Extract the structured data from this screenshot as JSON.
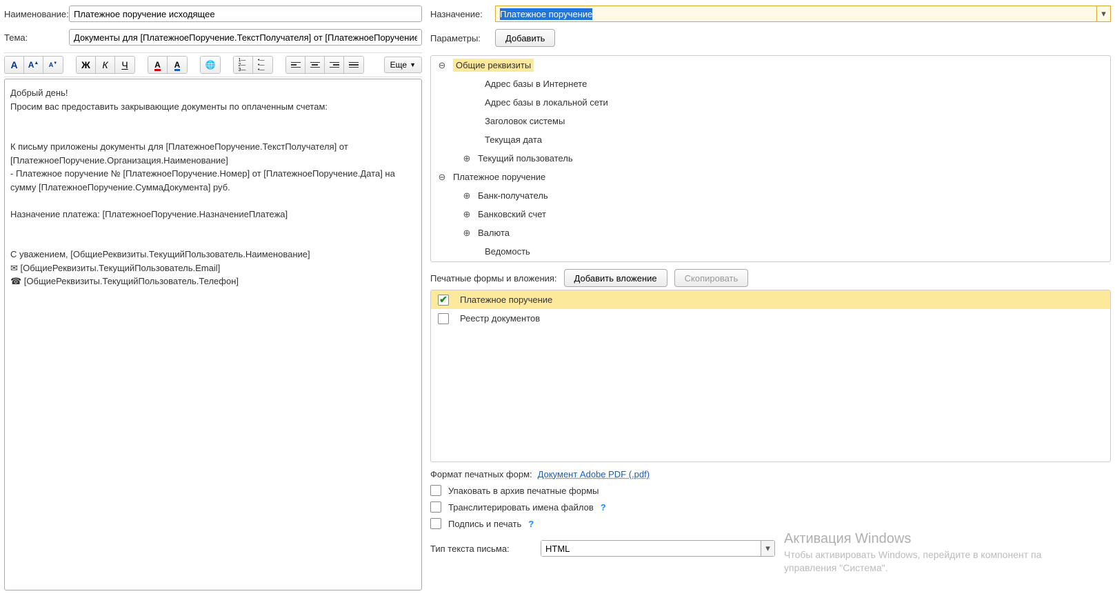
{
  "left": {
    "labels": {
      "name": "Наименование:",
      "subject": "Тема:"
    },
    "name_value": "Платежное поручение исходящее",
    "subject_value": "Документы для [ПлатежноеПоручение.ТекстПолучателя] от [ПлатежноеПоручение.Организа",
    "more_btn": "Еще",
    "body": "Добрый день!\nПросим вас предоставить закрывающие документы по оплаченным счетам:\n\n\nК письму приложены документы для [ПлатежноеПоручение.ТекстПолучателя] от [ПлатежноеПоручение.Организация.Наименование]\n- Платежное поручение № [ПлатежноеПоручение.Номер] от [ПлатежноеПоручение.Дата] на сумму [ПлатежноеПоручение.СуммаДокумента] руб.\n\nНазначение платежа: [ПлатежноеПоручение.НазначениеПлатежа]\n\n\nС уважением, [ОбщиеРеквизиты.ТекущийПользователь.Наименование]\n✉ [ОбщиеРеквизиты.ТекущийПользователь.Email]\n☎ [ОбщиеРеквизиты.ТекущийПользователь.Телефон]"
  },
  "right": {
    "labels": {
      "assignment": "Назначение:",
      "parameters": "Параметры:",
      "print_forms": "Печатные формы и вложения:",
      "format": "Формат печатных форм:",
      "email_type": "Тип текста письма:"
    },
    "assignment_value": "Платежное поручение",
    "add_btn": "Добавить",
    "add_attach_btn": "Добавить вложение",
    "copy_btn": "Скопировать",
    "format_value": "Документ Adobe PDF (.pdf)",
    "email_type_value": "HTML",
    "tree": [
      {
        "lvl": 0,
        "state": "expand",
        "label": "Общие реквизиты",
        "hl": true
      },
      {
        "lvl": 1,
        "state": "leaf",
        "label": "Адрес базы в Интернете"
      },
      {
        "lvl": 1,
        "state": "leaf",
        "label": "Адрес базы в локальной сети"
      },
      {
        "lvl": 1,
        "state": "leaf",
        "label": "Заголовок системы"
      },
      {
        "lvl": 1,
        "state": "leaf",
        "label": "Текущая дата"
      },
      {
        "lvl": 1,
        "state": "collapse",
        "label": "Текущий пользователь"
      },
      {
        "lvl": 0,
        "state": "expand",
        "label": "Платежное поручение"
      },
      {
        "lvl": 1,
        "state": "collapse",
        "label": "Банк-получатель"
      },
      {
        "lvl": 1,
        "state": "collapse",
        "label": "Банковский счет"
      },
      {
        "lvl": 1,
        "state": "collapse",
        "label": "Валюта"
      },
      {
        "lvl": 1,
        "state": "leaf",
        "label": "Ведомость"
      }
    ],
    "print_items": [
      {
        "label": "Платежное поручение",
        "checked": true,
        "sel": true
      },
      {
        "label": "Реестр документов",
        "checked": false,
        "sel": false
      }
    ],
    "checkboxes": {
      "pack": "Упаковать в архив печатные формы",
      "transliterate": "Транслитерировать имена файлов",
      "sign": "Подпись и печать"
    }
  },
  "watermark": {
    "title": "Активация Windows",
    "sub": "Чтобы активировать Windows, перейдите в компонент па\nуправления \"Система\"."
  }
}
